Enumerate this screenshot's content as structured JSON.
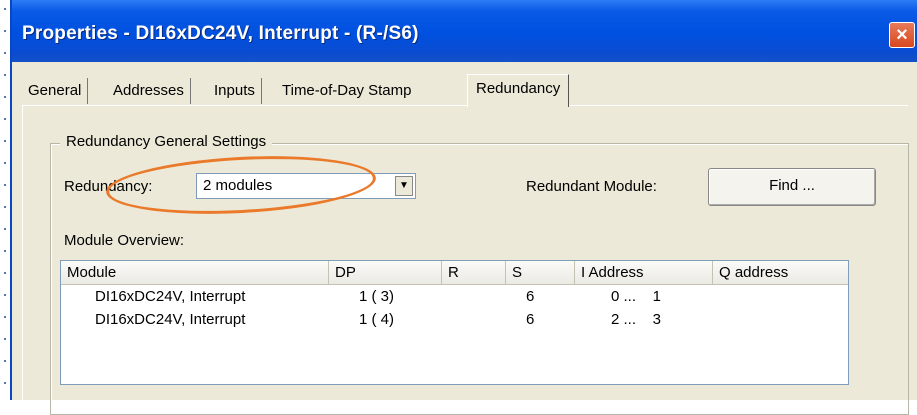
{
  "window": {
    "title": "Properties - DI16xDC24V, Interrupt - (R-/S6)",
    "close_glyph": "×",
    "colors": {
      "title_bar": "#0a54e0",
      "dialog_bg": "#ece9d8",
      "close_button": "#d8481e",
      "annotation": "#ea7a2a"
    }
  },
  "tabs": [
    {
      "label": "General"
    },
    {
      "label": "Addresses"
    },
    {
      "label": "Inputs"
    },
    {
      "label": "Time-of-Day Stamp"
    },
    {
      "label": "Redundancy",
      "active": true
    }
  ],
  "group": {
    "title": "Redundancy General Settings"
  },
  "redundancy": {
    "label": "Redundancy:",
    "value": "2 modules",
    "dropdown_icon": "triangle-down"
  },
  "redundant_module": {
    "label": "Redundant Module:",
    "find_button": "Find ..."
  },
  "overview": {
    "label": "Module Overview:",
    "columns": [
      "Module",
      "DP",
      "R",
      "S",
      "I Address",
      "Q address"
    ],
    "rows": [
      [
        "DI16xDC24V, Interrupt",
        "1 ( 3)",
        "",
        "6",
        "0 ...    1",
        ""
      ],
      [
        "DI16xDC24V, Interrupt",
        "1 ( 4)",
        "",
        "6",
        "2 ...    3",
        ""
      ]
    ]
  }
}
